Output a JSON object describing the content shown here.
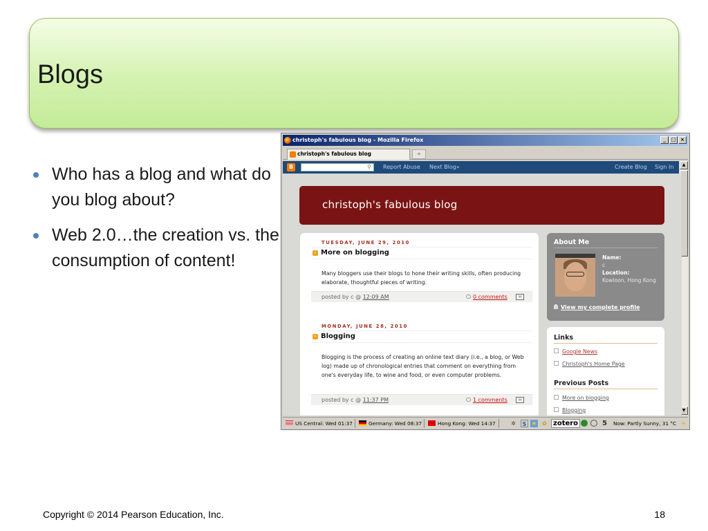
{
  "slide": {
    "title": "Blogs",
    "bullets": [
      "Who has a blog and what do you blog about?",
      "Web 2.0…the creation vs. the consumption of content!"
    ],
    "footer_copyright": "Copyright © 2014 Pearson Education, Inc.",
    "page_number": "18"
  },
  "browser": {
    "window_title": "christoph's fabulous blog - Mozilla Firefox",
    "window_buttons": [
      "_",
      "□",
      "×"
    ],
    "tab_label": "christoph's fabulous blog",
    "new_tab": "+",
    "navbar": {
      "report_abuse": "Report Abuse",
      "next_blog": "Next Blog»",
      "create_blog": "Create Blog",
      "sign_in": "Sign In"
    },
    "blog_title": "christoph's fabulous blog",
    "posts": [
      {
        "date": "TUESDAY, JUNE 29, 2010",
        "title": "More on blogging",
        "body": "Many bloggers use their blogs to hone their writing skills, often producing elaborate, thoughtful pieces of writing.",
        "posted_by": "posted by c @",
        "time": "12:09 AM",
        "comments": "0 comments"
      },
      {
        "date": "MONDAY, JUNE 28, 2010",
        "title": "Blogging",
        "body": "Blogging is the process of creating an online text diary (i.e., a blog, or Web log) made up of chronological entries that comment on everything from one's everyday life, to wine and food, or even computer problems.",
        "posted_by": "posted by c @",
        "time": "11:37 PM",
        "comments": "1 comments"
      }
    ],
    "about": {
      "heading": "About Me",
      "name_label": "Name:",
      "name_value": "c",
      "location_label": "Location:",
      "location_value": "Kowloon, Hong Kong",
      "profile_link": "View my complete profile"
    },
    "links": {
      "heading": "Links",
      "items": [
        "Google News",
        "Christoph's Home Page"
      ]
    },
    "previous_posts": {
      "heading": "Previous Posts",
      "items": [
        "More on blogging",
        "Blogging"
      ]
    },
    "statusbar": {
      "clock_us": "US Central: Wed 01:37",
      "clock_de": "Germany: Wed 08:37",
      "clock_hk": "Hong Kong: Wed 14:37",
      "zotero": "zotero",
      "weather": "Now: Partly Sunny, 31 °C",
      "five": "5"
    }
  }
}
